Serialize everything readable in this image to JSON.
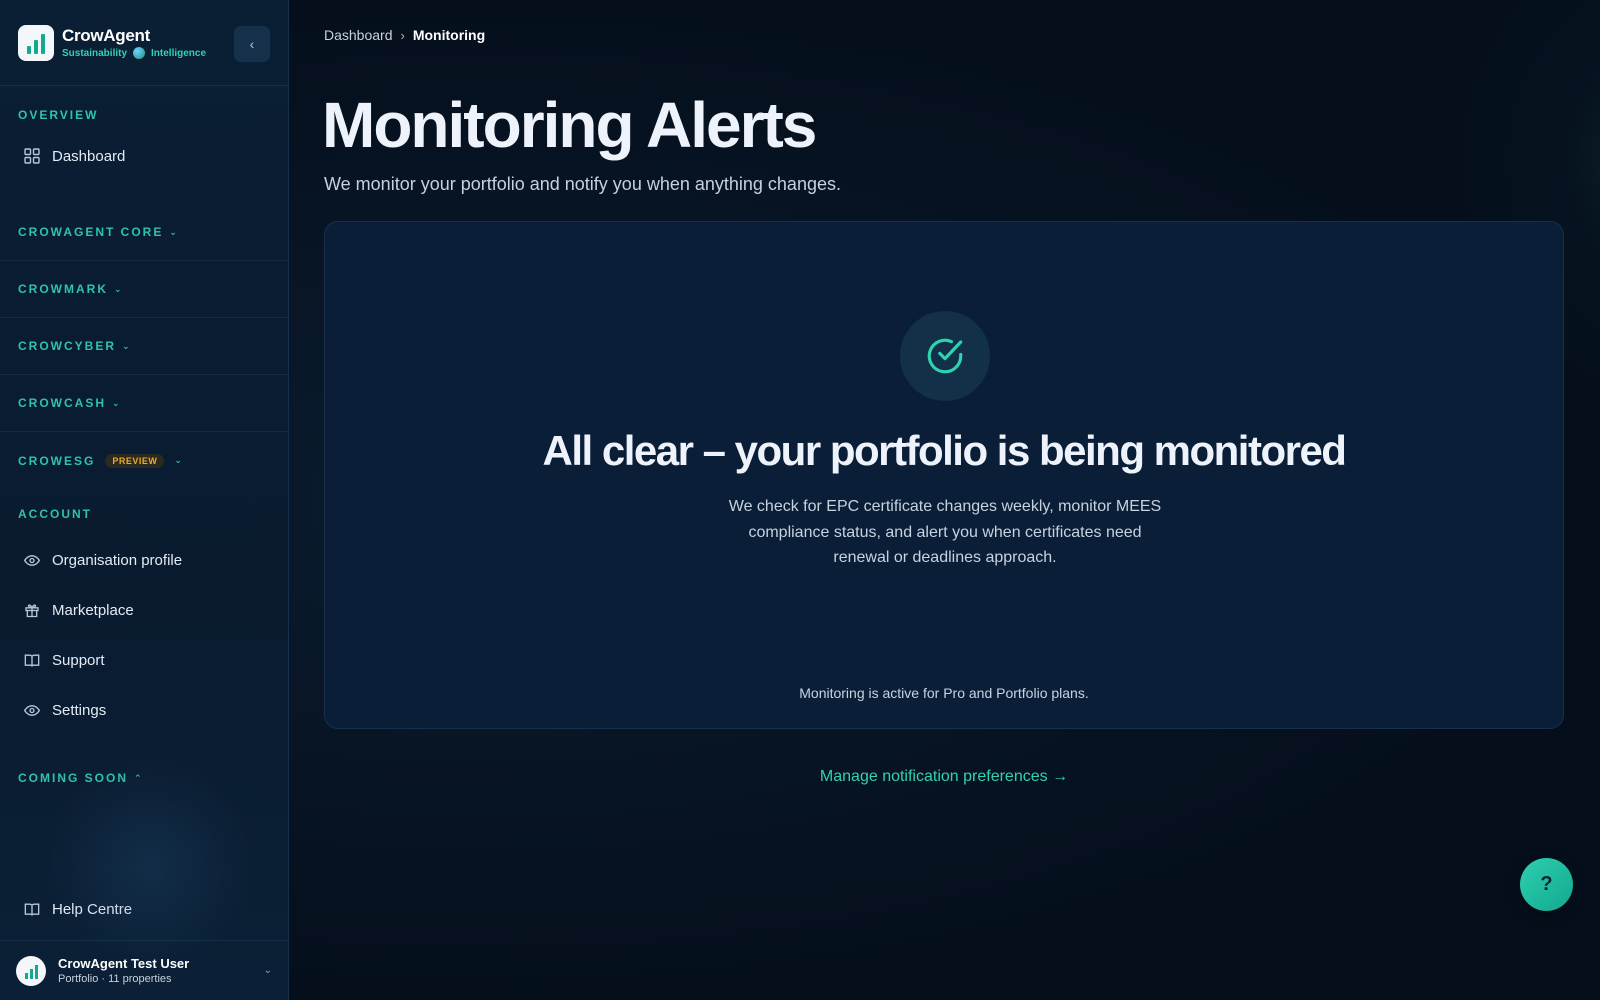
{
  "brand": {
    "name": "CrowAgent",
    "tagline_left": "Sustainability",
    "tagline_right": "Intelligence",
    "collapse_glyph": "‹"
  },
  "sidebar": {
    "overview_label": "OVERVIEW",
    "dashboard_label": "Dashboard",
    "groups": [
      {
        "label": "CROWAGENT CORE"
      },
      {
        "label": "CROWMARK"
      },
      {
        "label": "CROWCYBER"
      },
      {
        "label": "CROWCASH"
      },
      {
        "label": "CROWESG",
        "badge": "PREVIEW"
      }
    ],
    "chevron_down": "⌄",
    "chevron_up": "⌃",
    "account_label": "ACCOUNT",
    "account_items": [
      {
        "label": "Organisation profile",
        "icon": "eye-icon"
      },
      {
        "label": "Marketplace",
        "icon": "gift-icon"
      },
      {
        "label": "Support",
        "icon": "book-icon"
      },
      {
        "label": "Settings",
        "icon": "eye-icon"
      }
    ],
    "coming_soon_label": "COMING SOON",
    "help_centre_label": "Help Centre",
    "user": {
      "name": "CrowAgent Test User",
      "meta": "Portfolio · 11 properties"
    }
  },
  "breadcrumb": {
    "root": "Dashboard",
    "separator": "›",
    "current": "Monitoring"
  },
  "page": {
    "title": "Monitoring Alerts",
    "subtitle": "We monitor your portfolio and notify you when anything changes."
  },
  "card": {
    "title": "All clear – your portfolio is being monitored",
    "body": "We check for EPC certificate changes weekly, monitor MEES compliance status, and alert you when certificates need renewal or deadlines approach.",
    "note": "Monitoring is active for Pro and Portfolio plans."
  },
  "manage_link": "Manage notification preferences →",
  "help_fab": "?",
  "colors": {
    "accent": "#2fd3b1",
    "background": "#050f1c",
    "card": "#0b1e38",
    "preview_badge": "#f0a92d"
  }
}
